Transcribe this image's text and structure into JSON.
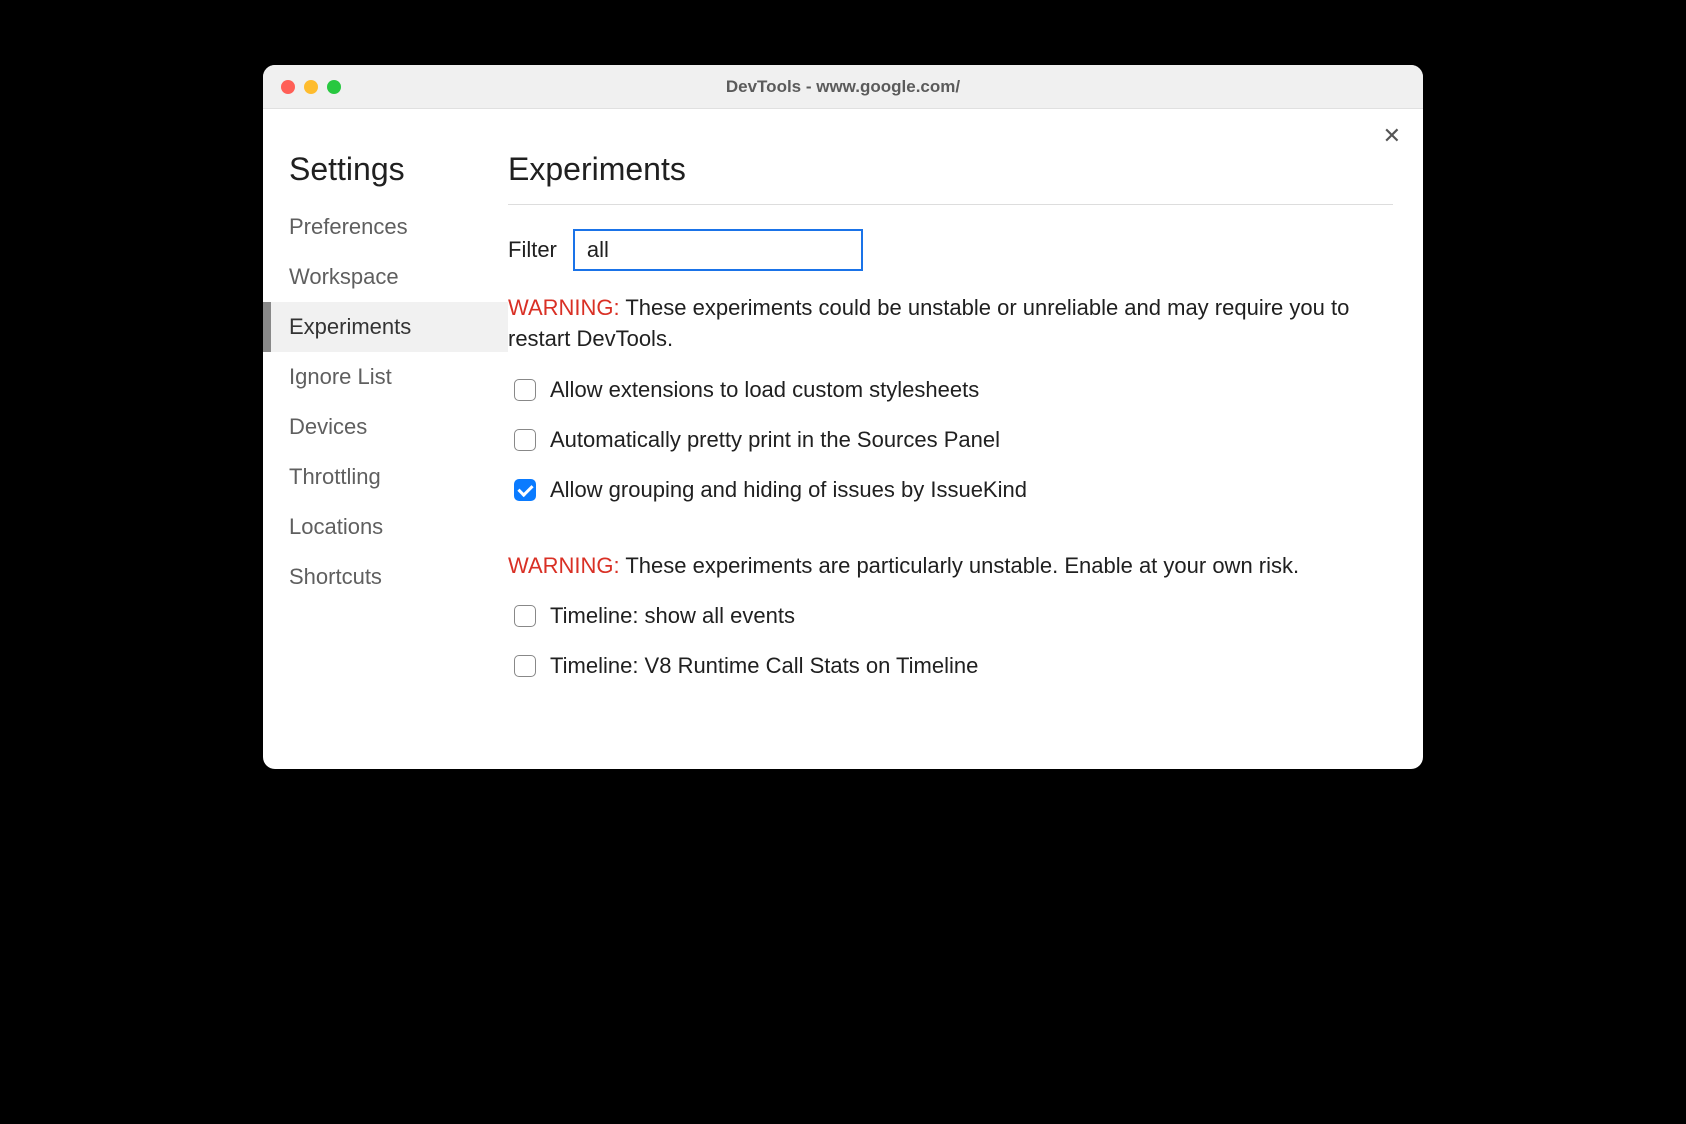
{
  "window": {
    "title": "DevTools - www.google.com/"
  },
  "sidebar": {
    "title": "Settings",
    "items": [
      {
        "label": "Preferences",
        "active": false
      },
      {
        "label": "Workspace",
        "active": false
      },
      {
        "label": "Experiments",
        "active": true
      },
      {
        "label": "Ignore List",
        "active": false
      },
      {
        "label": "Devices",
        "active": false
      },
      {
        "label": "Throttling",
        "active": false
      },
      {
        "label": "Locations",
        "active": false
      },
      {
        "label": "Shortcuts",
        "active": false
      }
    ]
  },
  "main": {
    "title": "Experiments",
    "filter_label": "Filter",
    "filter_value": "all",
    "warning1_label": "WARNING:",
    "warning1_text": " These experiments could be unstable or unreliable and may require you to restart DevTools.",
    "warning2_label": "WARNING:",
    "warning2_text": " These experiments are particularly unstable. Enable at your own risk.",
    "group1": [
      {
        "label": "Allow extensions to load custom stylesheets",
        "checked": false
      },
      {
        "label": "Automatically pretty print in the Sources Panel",
        "checked": false
      },
      {
        "label": "Allow grouping and hiding of issues by IssueKind",
        "checked": true
      }
    ],
    "group2": [
      {
        "label": "Timeline: show all events",
        "checked": false
      },
      {
        "label": "Timeline: V8 Runtime Call Stats on Timeline",
        "checked": false
      }
    ]
  }
}
